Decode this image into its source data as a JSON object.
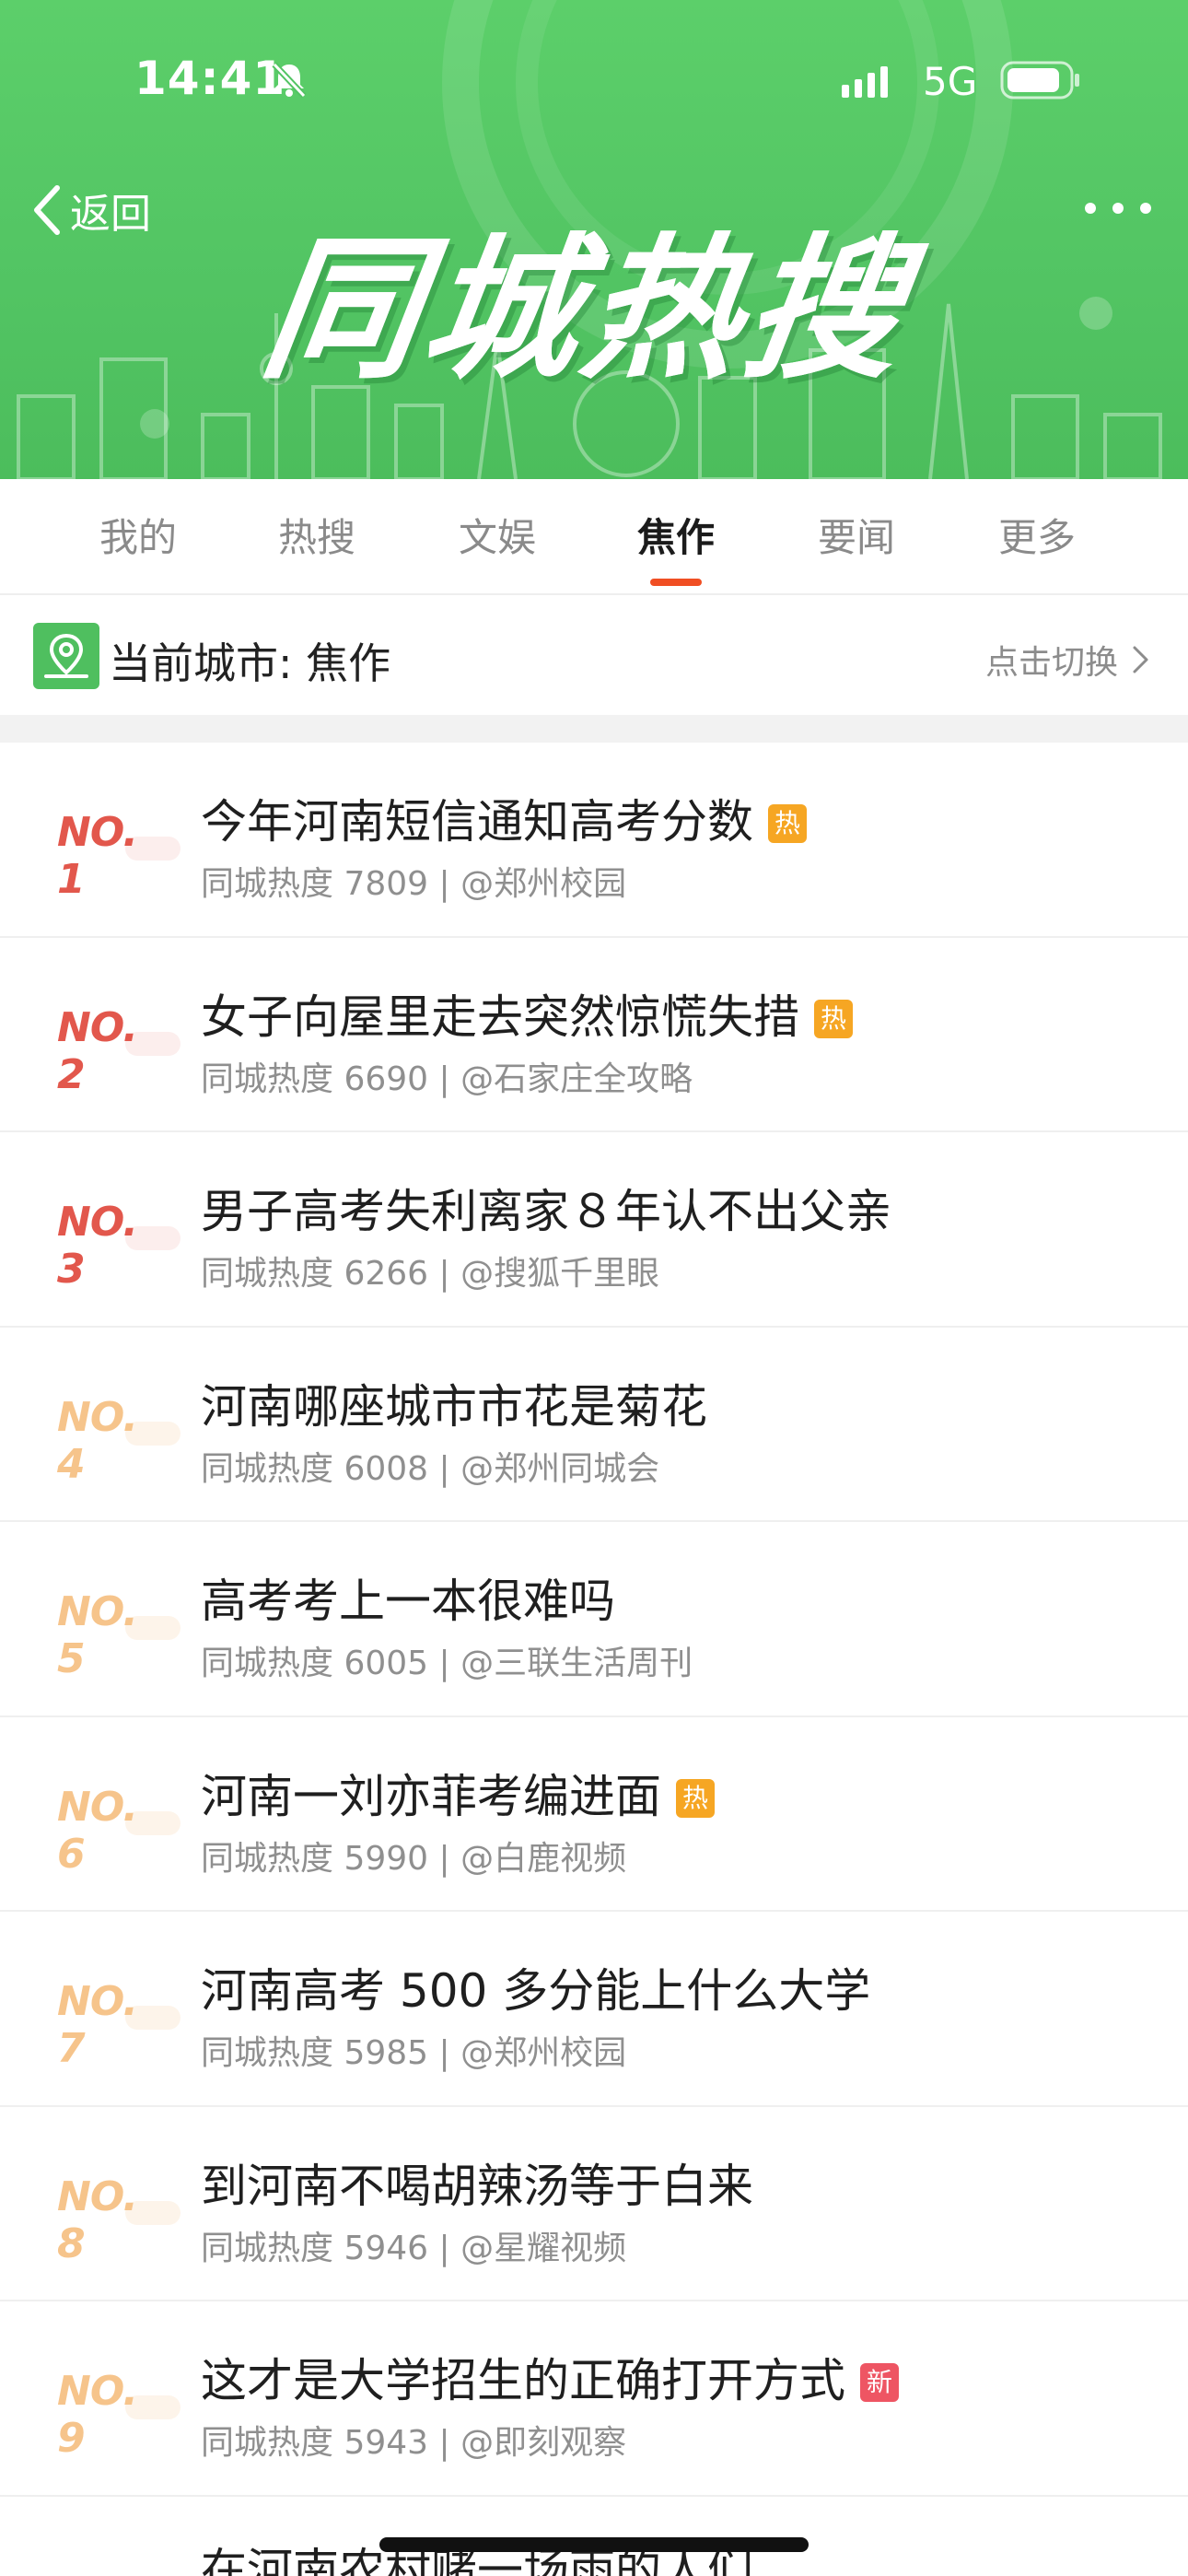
{
  "status_bar": {
    "time": "14:41",
    "network": "5G",
    "icons": [
      "bell-muted-icon",
      "signal-icon",
      "battery-icon"
    ]
  },
  "header": {
    "back_label": "返回",
    "banner_title": "同城热搜",
    "more_icon": "more-dots-icon"
  },
  "tabs": [
    {
      "label": "我的",
      "active": false
    },
    {
      "label": "热搜",
      "active": false
    },
    {
      "label": "文娱",
      "active": false
    },
    {
      "label": "焦作",
      "active": true
    },
    {
      "label": "要闻",
      "active": false
    },
    {
      "label": "更多",
      "active": false
    }
  ],
  "city": {
    "label": "当前城市: 焦作",
    "switch_label": "点击切换",
    "icon": "location-pin-icon"
  },
  "list": [
    {
      "rank": "NO. 1",
      "title": "今年河南短信通知高考分数",
      "badge": "热",
      "meta": "同城热度 7809 | @郑州校园"
    },
    {
      "rank": "NO. 2",
      "title": "女子向屋里走去突然惊慌失措",
      "badge": "热",
      "meta": "同城热度 6690 | @石家庄全攻略"
    },
    {
      "rank": "NO. 3",
      "title": "男子高考失利离家８年认不出父亲",
      "badge": "",
      "meta": "同城热度 6266 | @搜狐千里眼"
    },
    {
      "rank": "NO. 4",
      "title": "河南哪座城市市花是菊花",
      "badge": "",
      "meta": "同城热度 6008 | @郑州同城会"
    },
    {
      "rank": "NO. 5",
      "title": "高考考上一本很难吗",
      "badge": "",
      "meta": "同城热度 6005 | @三联生活周刊"
    },
    {
      "rank": "NO. 6",
      "title": "河南一刘亦菲考编进面",
      "badge": "热",
      "meta": "同城热度 5990 | @白鹿视频"
    },
    {
      "rank": "NO. 7",
      "title": "河南高考 500 多分能上什么大学",
      "badge": "",
      "meta": "同城热度 5985 | @郑州校园"
    },
    {
      "rank": "NO. 8",
      "title": "到河南不喝胡辣汤等于白来",
      "badge": "",
      "meta": "同城热度 5946 | @星耀视频"
    },
    {
      "rank": "NO. 9",
      "title": "这才是大学招生的正确打开方式",
      "badge": "新",
      "meta": "同城热度 5943 | @即刻观察"
    },
    {
      "rank": "",
      "title": "在河南农村赌一场雨的人们",
      "badge": "",
      "meta": ""
    }
  ],
  "colors": {
    "banner_green": "#52c463",
    "tab_indicator": "#f04e23",
    "rank_top": "#e2574c",
    "rank_mid": "#f28a3c",
    "rank_low": "#f6c48b",
    "badge_hot": "#f6a623",
    "badge_new": "#ee5563"
  }
}
